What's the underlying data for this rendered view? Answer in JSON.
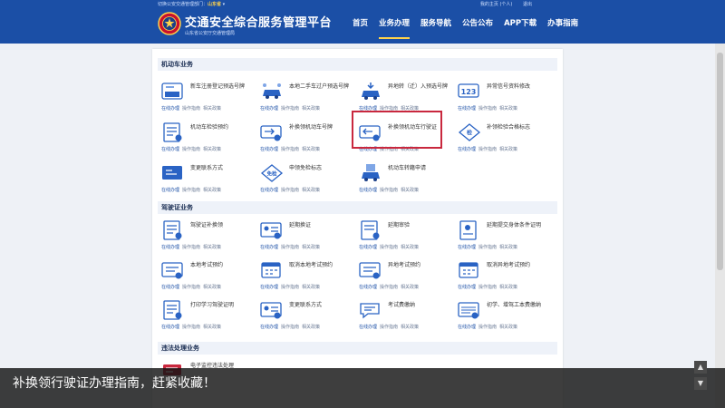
{
  "header": {
    "topline_prefix": "切换公安交通管理部门：",
    "topline_region": "山东省",
    "user_greeting": "我的主页 (个人)",
    "logout": "退出",
    "site_title": "交通安全综合服务管理平台",
    "site_subtitle": "山东省公安厅交通管理局",
    "nav": [
      "首页",
      "业务办理",
      "服务导航",
      "公告公布",
      "APP下载",
      "办事指南"
    ],
    "active_nav_index": 1
  },
  "sections": [
    {
      "title": "机动车业务",
      "items": [
        {
          "name": "新车注册登记预选号牌",
          "links": [
            "在线办理",
            "操作指南",
            "相关政策"
          ]
        },
        {
          "name": "本地二手车过户预选号牌",
          "links": [
            "在线办理",
            "操作指南",
            "相关政策"
          ]
        },
        {
          "name": "异地转（迁）入预选号牌",
          "links": [
            "在线办理",
            "操作指南",
            "相关政策"
          ]
        },
        {
          "name": "异常信号资料修改",
          "links": [
            "在线办理",
            "操作指南",
            "相关政策"
          ]
        },
        {
          "name": "机动车检验预约",
          "links": [
            "在线办理",
            "操作指南",
            "相关政策"
          ]
        },
        {
          "name": "补换领机动车号牌",
          "links": [
            "在线办理",
            "操作指南",
            "相关政策"
          ]
        },
        {
          "name": "补换领机动车行驶证",
          "links": [
            "在线办理",
            "操作指南",
            "相关政策"
          ]
        },
        {
          "name": "补领检验合格标志",
          "links": [
            "在线办理",
            "操作指南",
            "相关政策"
          ]
        },
        {
          "name": "变更联系方式",
          "links": [
            "在线办理",
            "操作指南",
            "相关政策"
          ]
        },
        {
          "name": "申领免检标志",
          "links": [
            "在线办理",
            "操作指南",
            "相关政策"
          ]
        },
        {
          "name": "机动车转籍申请",
          "links": [
            "在线办理",
            "操作指南",
            "相关政策"
          ]
        }
      ]
    },
    {
      "title": "驾驶证业务",
      "items": [
        {
          "name": "驾驶证补换领",
          "links": [
            "在线办理",
            "操作指南",
            "相关政策"
          ]
        },
        {
          "name": "延期换证",
          "links": [
            "在线办理",
            "操作指南",
            "相关政策"
          ]
        },
        {
          "name": "延期审验",
          "links": [
            "在线办理",
            "操作指南",
            "相关政策"
          ]
        },
        {
          "name": "延期提交身体条件证明",
          "links": [
            "在线办理",
            "操作指南",
            "相关政策"
          ]
        },
        {
          "name": "本地考试预约",
          "links": [
            "在线办理",
            "操作指南",
            "相关政策"
          ]
        },
        {
          "name": "取消本地考试预约",
          "links": [
            "在线办理",
            "操作指南",
            "相关政策"
          ]
        },
        {
          "name": "异地考试预约",
          "links": [
            "在线办理",
            "操作指南",
            "相关政策"
          ]
        },
        {
          "name": "取消异地考试预约",
          "links": [
            "在线办理",
            "操作指南",
            "相关政策"
          ]
        },
        {
          "name": "打印学习驾驶证明",
          "links": [
            "在线办理",
            "操作指南",
            "相关政策"
          ]
        },
        {
          "name": "变更联系方式",
          "links": [
            "在线办理",
            "操作指南",
            "相关政策"
          ]
        },
        {
          "name": "考试费缴纳",
          "links": [
            "在线办理",
            "操作指南",
            "相关政策"
          ]
        },
        {
          "name": "初学、增驾工本费缴纳",
          "links": [
            "在线办理",
            "操作指南",
            "相关政策"
          ]
        }
      ]
    },
    {
      "title": "违法处理业务",
      "items": [
        {
          "name": "电子监控违法处理",
          "links": []
        }
      ]
    }
  ],
  "caption": "补换领行驶证办理指南，赶紧收藏！",
  "colors": {
    "brand": "#1b4fa6",
    "highlight": "#c9283e",
    "accent": "#ffd24a"
  },
  "icons": [
    "police-emblem-icon",
    "document-icon",
    "car-icon",
    "calendar-icon",
    "search-icon",
    "message-icon"
  ]
}
